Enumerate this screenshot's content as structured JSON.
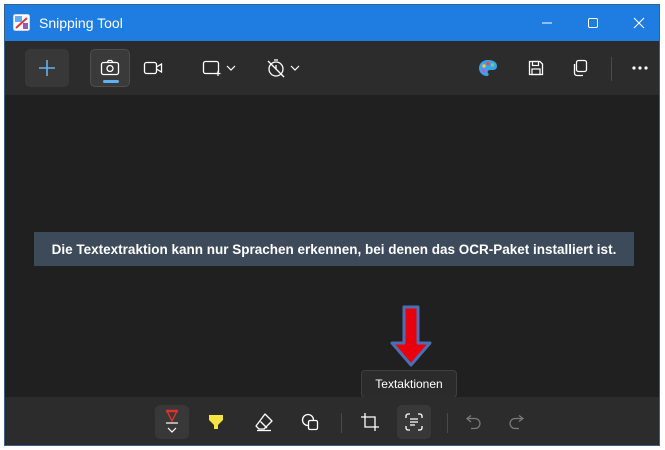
{
  "window": {
    "title": "Snipping Tool"
  },
  "toolbar": {
    "buttons": [
      {
        "name": "new-snip",
        "icon": "plus-icon"
      },
      {
        "name": "screenshot-mode",
        "icon": "camera-icon",
        "selected": true
      },
      {
        "name": "video-mode",
        "icon": "video-icon"
      },
      {
        "name": "snip-mode",
        "icon": "rectangle-snip-icon"
      },
      {
        "name": "delay",
        "icon": "timer-off-icon"
      },
      {
        "name": "open-paint",
        "icon": "paint-palette-icon"
      },
      {
        "name": "save",
        "icon": "save-icon"
      },
      {
        "name": "copy",
        "icon": "copy-icon"
      },
      {
        "name": "more",
        "icon": "ellipsis-icon"
      }
    ]
  },
  "canvas": {
    "message": "Die Textextraktion kann nur Sprachen erkennen, bei denen das OCR-Paket installiert ist.",
    "tooltip": "Textaktionen"
  },
  "bottom_toolbar": {
    "tools": [
      {
        "name": "ballpoint-pen",
        "icon": "pen-icon",
        "color": "#e0302a",
        "selected": true
      },
      {
        "name": "highlighter",
        "icon": "highlighter-icon",
        "color": "#f5e442"
      },
      {
        "name": "eraser",
        "icon": "eraser-icon"
      },
      {
        "name": "shapes",
        "icon": "shapes-icon"
      },
      {
        "name": "crop",
        "icon": "crop-icon"
      },
      {
        "name": "text-actions",
        "icon": "text-actions-icon",
        "selected": true
      },
      {
        "name": "undo",
        "icon": "undo-icon",
        "disabled": true
      },
      {
        "name": "redo",
        "icon": "redo-icon",
        "disabled": true
      }
    ]
  },
  "colors": {
    "titlebar": "#1f7ce0",
    "background": "#202020",
    "toolbar": "#2c2c2c",
    "accent": "#5fb2f2",
    "annotation_arrow": "#e8000d"
  }
}
